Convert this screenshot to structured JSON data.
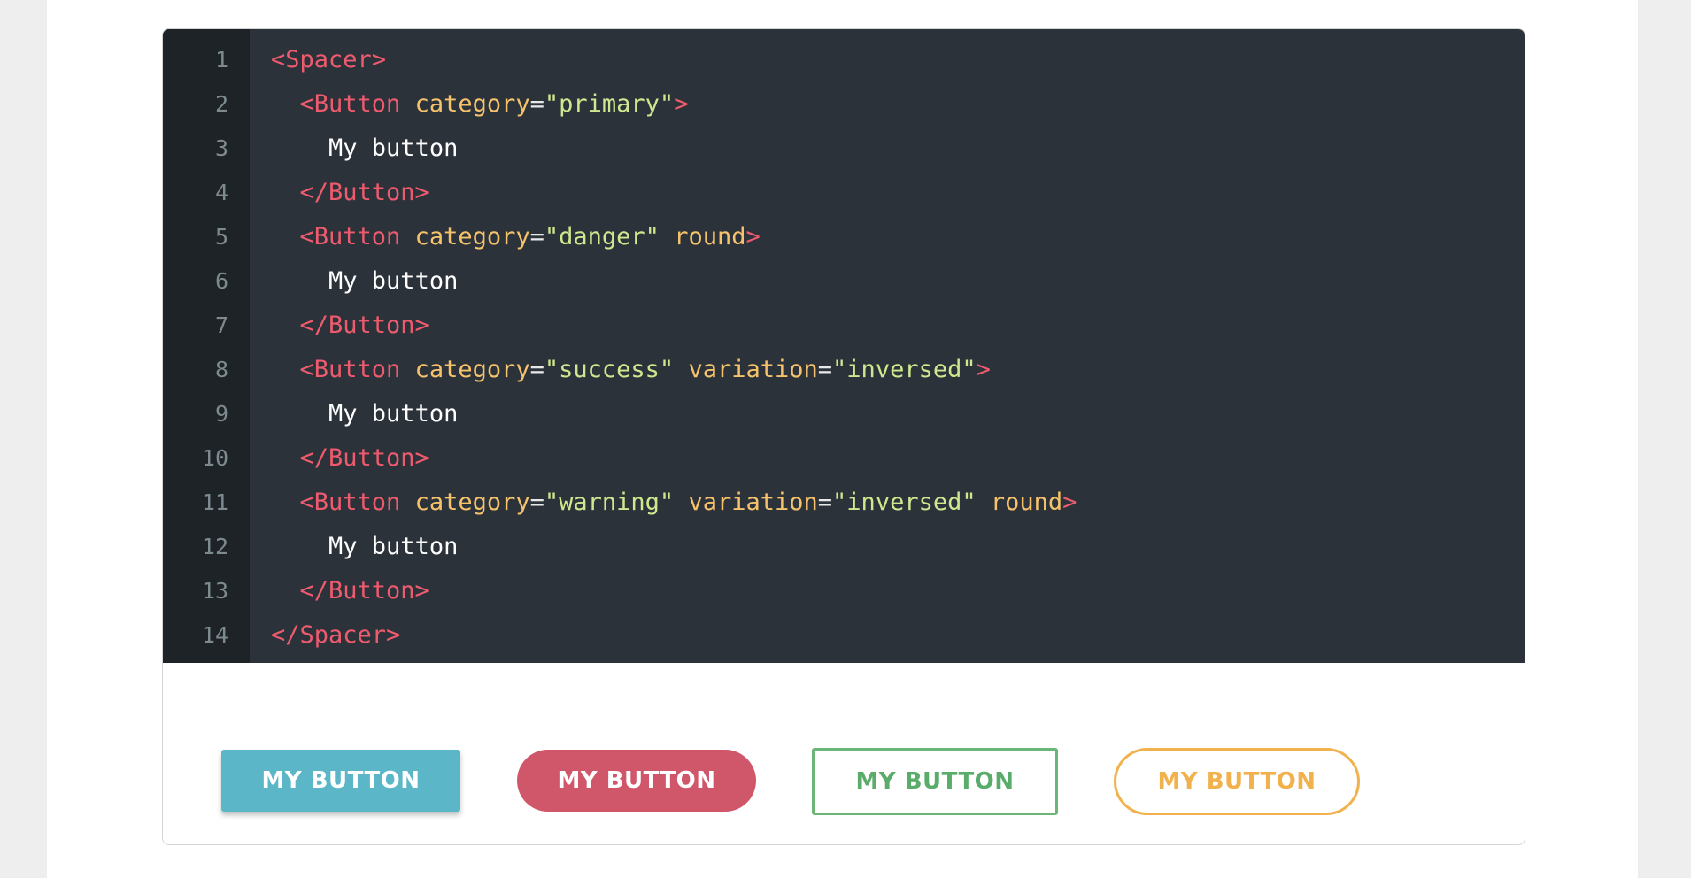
{
  "line_numbers": [
    "1",
    "2",
    "3",
    "4",
    "5",
    "6",
    "7",
    "8",
    "9",
    "10",
    "11",
    "12",
    "13",
    "14"
  ],
  "code": {
    "l1_open": "<Spacer>",
    "l2_tag": "<Button",
    "l2_attr": "category",
    "l2_eq": "=",
    "l2_val": "\"primary\"",
    "l2_close": ">",
    "l3_text": "My button",
    "l4_close": "</Button>",
    "l5_tag": "<Button",
    "l5_attr": "category",
    "l5_eq": "=",
    "l5_val": "\"danger\"",
    "l5_attr2": "round",
    "l5_close": ">",
    "l6_text": "My button",
    "l7_close": "</Button>",
    "l8_tag": "<Button",
    "l8_attr": "category",
    "l8_eq": "=",
    "l8_val": "\"success\"",
    "l8_attr2": "variation",
    "l8_eq2": "=",
    "l8_val2": "\"inversed\"",
    "l8_close": ">",
    "l9_text": "My button",
    "l10_close": "</Button>",
    "l11_tag": "<Button",
    "l11_attr": "category",
    "l11_eq": "=",
    "l11_val": "\"warning\"",
    "l11_attr2": "variation",
    "l11_eq2": "=",
    "l11_val2": "\"inversed\"",
    "l11_attr3": "round",
    "l11_close": ">",
    "l12_text": "My button",
    "l13_close": "</Button>",
    "l14_close": "</Spacer>"
  },
  "preview": {
    "primary_label": "MY BUTTON",
    "danger_label": "MY BUTTON",
    "success_label": "MY BUTTON",
    "warning_label": "MY BUTTON"
  },
  "colors": {
    "editor_bg": "#2b323a",
    "gutter_bg": "#1e2327",
    "tag": "#ef5b6e",
    "attribute": "#f6c26b",
    "string": "#cfe88f",
    "primary": "#5bb7c7",
    "danger": "#d0566a",
    "success": "#6bb676",
    "warning": "#f1b24e"
  }
}
